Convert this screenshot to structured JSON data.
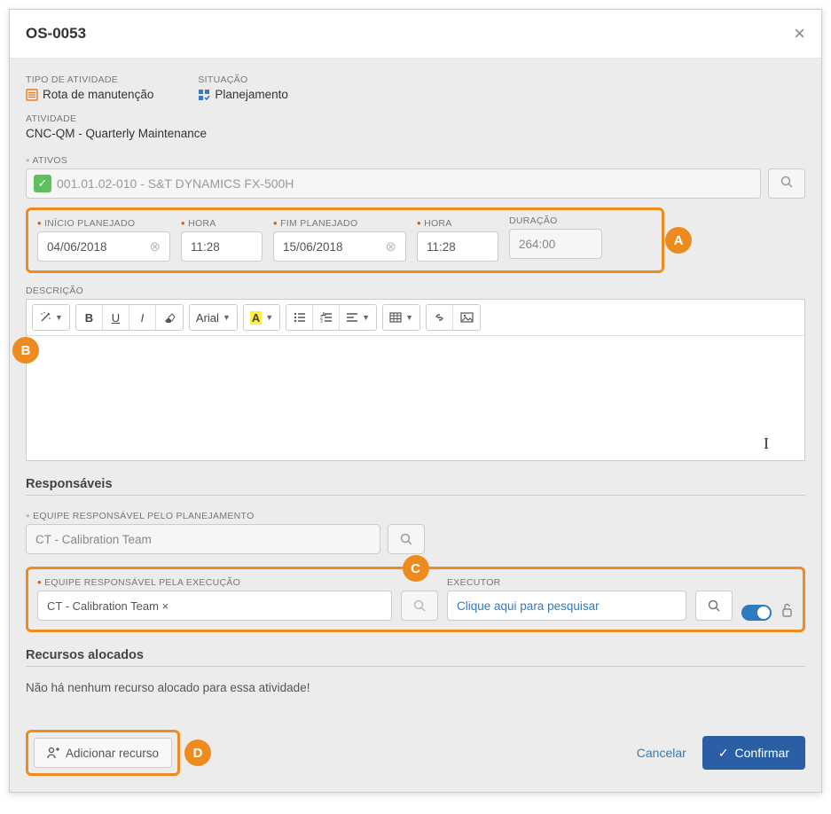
{
  "header": {
    "title": "OS-0053"
  },
  "activity_type": {
    "label": "TIPO DE ATIVIDADE",
    "value": "Rota de manutenção"
  },
  "status": {
    "label": "SITUAÇÃO",
    "value": "Planejamento"
  },
  "activity": {
    "label": "ATIVIDADE",
    "value": "CNC-QM - Quarterly Maintenance"
  },
  "assets": {
    "label": "ATIVOS",
    "value": "001.01.02-010 - S&T DYNAMICS FX-500H"
  },
  "dates": {
    "start": {
      "label": "INÍCIO PLANEJADO",
      "value": "04/06/2018"
    },
    "startTime": {
      "label": "HORA",
      "value": "11:28"
    },
    "end": {
      "label": "FIM PLANEJADO",
      "value": "15/06/2018"
    },
    "endTime": {
      "label": "HORA",
      "value": "11:28"
    },
    "duration": {
      "label": "DURAÇÃO",
      "value": "264:00"
    }
  },
  "description": {
    "label": "DESCRIÇÃO"
  },
  "editor": {
    "font": "Arial"
  },
  "responsibles": {
    "title": "Responsáveis",
    "planning": {
      "label": "EQUIPE RESPONSÁVEL PELO PLANEJAMENTO",
      "value": "CT - Calibration Team"
    },
    "execution": {
      "label": "EQUIPE RESPONSÁVEL PELA EXECUÇÃO",
      "chip": "CT - Calibration Team ×"
    },
    "executor": {
      "label": "EXECUTOR",
      "placeholder": "Clique aqui para pesquisar"
    }
  },
  "resources": {
    "title": "Recursos alocados",
    "empty": "Não há nenhum recurso alocado para essa atividade!",
    "addButton": "Adicionar recurso"
  },
  "actions": {
    "cancel": "Cancelar",
    "confirm": "Confirmar"
  },
  "callouts": {
    "A": "A",
    "B": "B",
    "C": "C",
    "D": "D"
  }
}
